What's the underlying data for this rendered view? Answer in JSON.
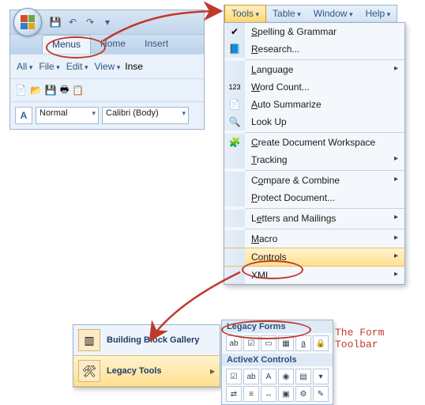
{
  "ribbon": {
    "tabs": {
      "menus": "Menus",
      "home": "Home",
      "insert": "Insert"
    },
    "group1": {
      "all": "All",
      "file": "File",
      "edit": "Edit",
      "view": "View",
      "ins": "Inse"
    },
    "style_box": "Normal",
    "font_box": "Calibri (Body)"
  },
  "menubar": {
    "tools": "Tools",
    "table": "Table",
    "window": "Window",
    "help": "Help"
  },
  "tools_menu": {
    "spelling": "Spelling & Grammar",
    "research": "Research...",
    "language": "Language",
    "word_count": "Word Count...",
    "auto_summarize": "Auto Summarize",
    "look_up": "Look Up",
    "create_workspace": "Create Document Workspace",
    "tracking": "Tracking",
    "compare": "Compare & Combine",
    "protect": "Protect Document...",
    "letters": "Letters and Mailings",
    "macro": "Macro",
    "controls": "Controls",
    "xml": "XML"
  },
  "gallery": {
    "building_block": "Building Block Gallery",
    "legacy_tools": "Legacy Tools"
  },
  "legacy_panel": {
    "forms_head": "Legacy Forms",
    "activex_head": "ActiveX Controls"
  },
  "caption": "The Form Toolbar"
}
